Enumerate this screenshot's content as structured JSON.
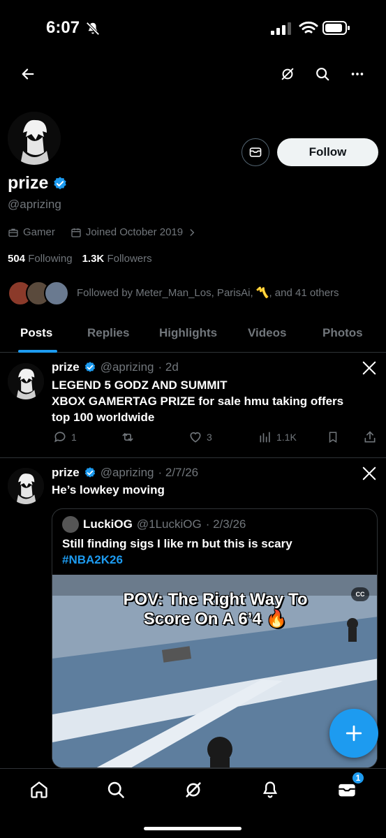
{
  "status_bar": {
    "time": "6:07"
  },
  "profile": {
    "name": "prize",
    "handle": "@aprizing",
    "category": "Gamer",
    "joined": "Joined October 2019",
    "following_count": "504",
    "following_label": "Following",
    "followers_count": "1.3K",
    "followers_label": "Followers",
    "followed_by": "Followed by Meter_Man_Los, ParisAi, ",
    "followed_by_emoji": "〽️",
    "followed_by_suffix": ", and 41 others",
    "follow_label": "Follow"
  },
  "tabs": [
    {
      "label": "Posts",
      "active": true
    },
    {
      "label": "Replies"
    },
    {
      "label": "Highlights"
    },
    {
      "label": "Videos"
    },
    {
      "label": "Photos"
    }
  ],
  "posts": [
    {
      "name": "prize",
      "handle": "@aprizing",
      "time": "· 2d",
      "text_lines": [
        "LEGEND 5 GODZ AND SUMMIT",
        "XBOX GAMERTAG PRIZE for sale hmu taking offers",
        "top 100 worldwide"
      ],
      "replies": "1",
      "likes": "3",
      "views": "1.1K"
    },
    {
      "name": "prize",
      "handle": "@aprizing",
      "time": "· 2/7/26",
      "text": "He’s lowkey moving",
      "quote": {
        "name": "LuckiOG",
        "handle": "@1LuckiOG",
        "time": "· 2/3/26",
        "text": "Still finding sigs I like rn but this is scary",
        "hashtag": "#NBA2K26",
        "video_caption_1": "POV: The Right Way To",
        "video_caption_2": "Score On A 6’4 🔥",
        "cc": "CC"
      }
    }
  ],
  "nav": {
    "badge": "1"
  },
  "colors": {
    "accent": "#1d9bf0",
    "bg": "#000000",
    "muted": "#71767b"
  }
}
